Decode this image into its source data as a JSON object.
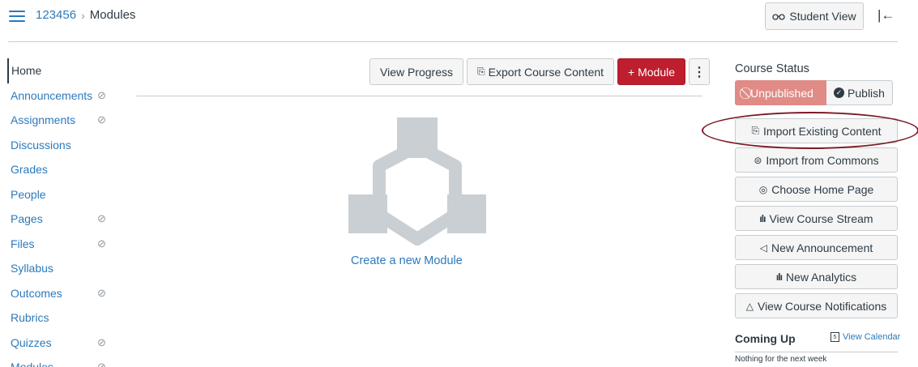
{
  "header": {
    "course_id": "123456",
    "separator": "›",
    "current_page": "Modules",
    "student_view_label": "Student View",
    "student_view_icon": "glasses-icon",
    "collapse_icon": "collapse-left-icon"
  },
  "nav": {
    "items": [
      {
        "label": "Home",
        "hidden": false
      },
      {
        "label": "Announcements",
        "hidden": true
      },
      {
        "label": "Assignments",
        "hidden": true
      },
      {
        "label": "Discussions",
        "hidden": false
      },
      {
        "label": "Grades",
        "hidden": false
      },
      {
        "label": "People",
        "hidden": false
      },
      {
        "label": "Pages",
        "hidden": true
      },
      {
        "label": "Files",
        "hidden": true
      },
      {
        "label": "Syllabus",
        "hidden": false
      },
      {
        "label": "Outcomes",
        "hidden": true
      },
      {
        "label": "Rubrics",
        "hidden": false
      },
      {
        "label": "Quizzes",
        "hidden": true
      },
      {
        "label": "Modules",
        "hidden": true
      }
    ],
    "active_index": 0
  },
  "toolbar": {
    "view_progress_label": "View Progress",
    "export_label": "Export Course Content",
    "add_module_label": "+ Module",
    "kebab_label": "⋮"
  },
  "main": {
    "create_module_label": "Create a new Module"
  },
  "sidebar": {
    "course_status_label": "Course Status",
    "unpublished_label": "Unpublished",
    "publish_label": "Publish",
    "buttons": [
      {
        "label": "Import Existing Content",
        "icon": "import-icon",
        "glyph": "⎘"
      },
      {
        "label": "Import from Commons",
        "icon": "commons-icon",
        "glyph": "⊜"
      },
      {
        "label": "Choose Home Page",
        "icon": "target-icon",
        "glyph": "◎"
      },
      {
        "label": "View Course Stream",
        "icon": "bar-chart-icon",
        "glyph": "ılı"
      },
      {
        "label": "New Announcement",
        "icon": "megaphone-icon",
        "glyph": "◁"
      },
      {
        "label": "New Analytics",
        "icon": "bar-chart-icon",
        "glyph": "ılı"
      },
      {
        "label": "View Course Notifications",
        "icon": "bell-icon",
        "glyph": "△"
      }
    ],
    "coming_up_label": "Coming Up",
    "view_calendar_label": "View Calendar",
    "calendar_day": "5",
    "nothing_next_label": "Nothing for the next week"
  },
  "colors": {
    "link": "#2b7abc",
    "primary_button": "#be1e2d",
    "unpublished": "#e08b86",
    "highlight_oval": "#7a1b26"
  }
}
